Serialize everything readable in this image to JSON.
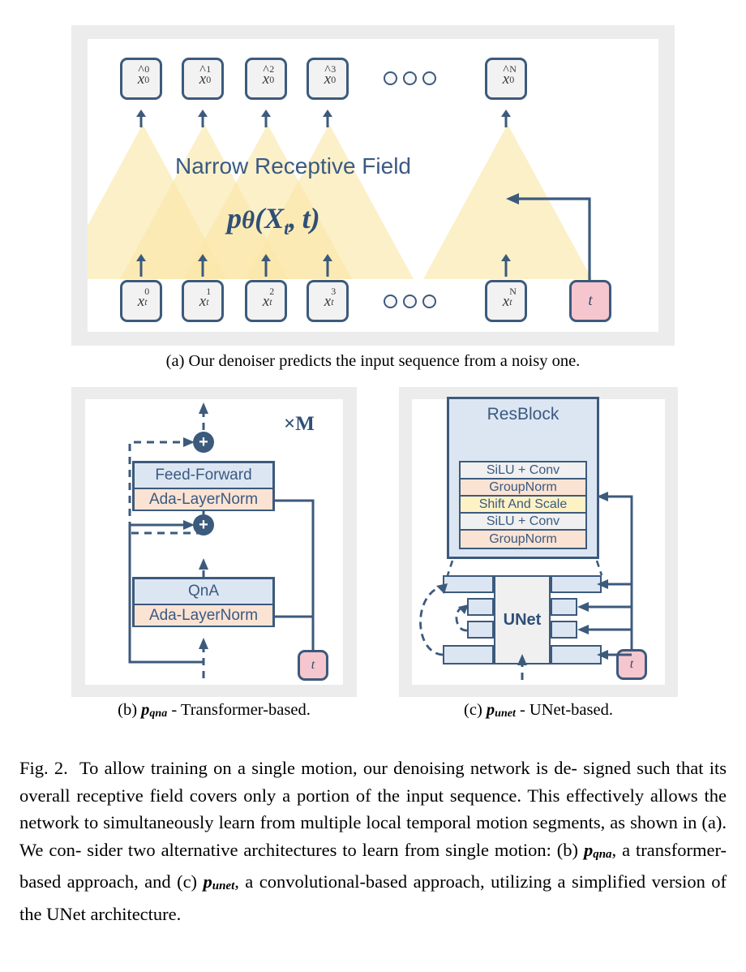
{
  "figure": {
    "panel_a": {
      "label": "(a)",
      "caption": "(a) Our denoiser predicts the input sequence from a noisy one.",
      "receptive_field_label": "Narrow Receptive Field",
      "model_label": "pθ(Xt, t)",
      "outputs": [
        {
          "base": "x",
          "hat": true,
          "sup": "0",
          "sub": "0"
        },
        {
          "base": "x",
          "hat": true,
          "sup": "1",
          "sub": "0"
        },
        {
          "base": "x",
          "hat": true,
          "sup": "2",
          "sub": "0"
        },
        {
          "base": "x",
          "hat": true,
          "sup": "3",
          "sub": "0"
        },
        {
          "base": "x",
          "hat": true,
          "sup": "N",
          "sub": "0"
        }
      ],
      "inputs": [
        {
          "base": "x",
          "hat": false,
          "sup": "0",
          "sub": "t"
        },
        {
          "base": "x",
          "hat": false,
          "sup": "1",
          "sub": "t"
        },
        {
          "base": "x",
          "hat": false,
          "sup": "2",
          "sub": "t"
        },
        {
          "base": "x",
          "hat": false,
          "sup": "3",
          "sub": "t"
        },
        {
          "base": "x",
          "hat": false,
          "sup": "N",
          "sub": "t"
        }
      ],
      "timestep_label": "t",
      "ellipsis_count": 3
    },
    "panel_b": {
      "label": "(b)",
      "caption_prefix": "(b) ",
      "caption_symbol": "p",
      "caption_symbol_sub": "qna",
      "caption_suffix": " - Transformer-based.",
      "repeat_label": "×M",
      "blocks": [
        {
          "main": "Feed-Forward",
          "norm": "Ada-LayerNorm"
        },
        {
          "main": "QnA",
          "norm": "Ada-LayerNorm"
        }
      ],
      "plus_symbol": "+",
      "timestep_label": "t"
    },
    "panel_c": {
      "label": "(c)",
      "caption_prefix": "(c) ",
      "caption_symbol": "p",
      "caption_symbol_sub": "unet",
      "caption_suffix": " - UNet-based.",
      "resblock_title": "ResBlock",
      "resblock_rows": [
        {
          "text": "SiLU + Conv",
          "color": "gray"
        },
        {
          "text": "GroupNorm",
          "color": "peach"
        },
        {
          "text": "Shift And Scale",
          "color": "yellow"
        },
        {
          "text": "SiLU + Conv",
          "color": "gray"
        },
        {
          "text": "GroupNorm",
          "color": "peach"
        }
      ],
      "unet_label": "UNet",
      "timestep_label": "t"
    },
    "main_caption": {
      "prefix": "Fig. 2.",
      "line1": "To allow training on a single motion, our denoising network is de-",
      "line2": "signed such that its overall receptive field covers only a portion of the",
      "line3": "input sequence. This effectively allows the network to simultaneously learn",
      "line4": "from multiple local temporal motion segments, as shown in (a). We con-",
      "line5a": "sider two alternative architectures to learn from single motion: (b) ",
      "line5_sym": "p",
      "line5_sub": "qna",
      "line5b": ", a",
      "line6a": "transformer-based approach, and (c) ",
      "line6_sym": "p",
      "line6_sub": "unet",
      "line6b": ", a convolutional-based approach,",
      "line7": "utilizing a simplified version of the UNet architecture."
    },
    "colors": {
      "ink": "#3c5a7c",
      "cone": "#fae8b0",
      "pink": "#f6c6ce",
      "blue_row": "#dce6f2",
      "peach_row": "#fbe3d3",
      "yellow_row": "#fdf2c4",
      "panel_bg": "#ececec"
    }
  }
}
